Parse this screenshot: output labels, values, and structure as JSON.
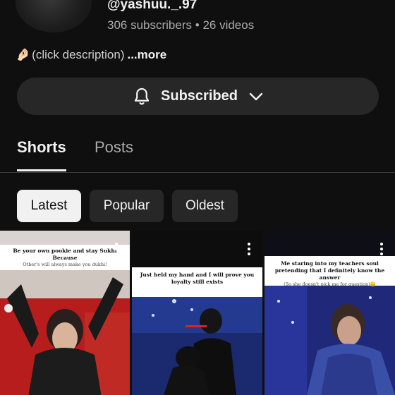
{
  "channel": {
    "handle": "@yashuu._.97",
    "subscribers": "306 subscribers",
    "separator": "•",
    "videos": "26 videos",
    "description_emoji": "🤌🏻",
    "description": "(click description)",
    "more": "...more"
  },
  "subscribe_button": {
    "label": "Subscribed",
    "bell_icon": "bell-icon",
    "chevron_icon": "chevron-down-icon"
  },
  "tabs": [
    {
      "label": "Shorts",
      "active": true
    },
    {
      "label": "Posts",
      "active": false
    }
  ],
  "filters": [
    {
      "label": "Latest",
      "selected": true
    },
    {
      "label": "Popular",
      "selected": false
    },
    {
      "label": "Oldest",
      "selected": false
    }
  ],
  "shorts": [
    {
      "caption": "Be your own pookie and stay Sukhi Because",
      "subcaption": "Other's will always make you dukhi!"
    },
    {
      "caption": "Just held my hand and I will prove you loyalty still exists",
      "subcaption": ""
    },
    {
      "caption": "Me staring into my teachers soul pretending that I definitely know the answer",
      "subcaption": "(So she doesn't pick me for question)😞"
    }
  ],
  "colors": {
    "background": "#0f0f0f",
    "button_bg": "#272727",
    "chip_selected_bg": "#f1f1f1",
    "text_primary": "#f1f1f1",
    "text_secondary": "#aaaaaa"
  }
}
